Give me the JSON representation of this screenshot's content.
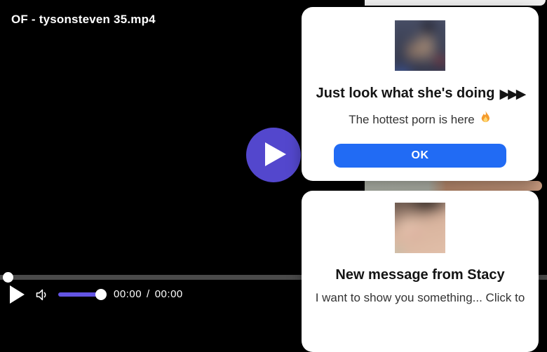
{
  "player": {
    "title": "OF - tysonsteven 35.mp4",
    "controls": {
      "current_time": "00:00",
      "separator": "/",
      "duration": "00:00",
      "progress_percent": 0,
      "volume_percent": 100
    },
    "icons": {
      "big_play": "play-icon",
      "play": "play-icon",
      "volume": "speaker-icon"
    },
    "colors": {
      "background": "#000000",
      "big_play_button": "#5347CD",
      "volume_slider": "#6355E4",
      "progress_track": "#4A4A4A"
    }
  },
  "overlays": {
    "offer_popup": {
      "thumbnail_icon": "webcam-scene-thumbnail",
      "heading": "Just look what she's doing",
      "heading_arrows": "▶▶▶",
      "subtext": "The hottest porn is here",
      "subtext_emoji": "🔥",
      "ok_label": "OK",
      "colors": {
        "ok_button": "#216BF4"
      }
    },
    "message_popup": {
      "thumbnail_icon": "stacy-avatar-thumbnail",
      "heading": "New message from Stacy",
      "body": "I want to show you something... Click to"
    }
  }
}
